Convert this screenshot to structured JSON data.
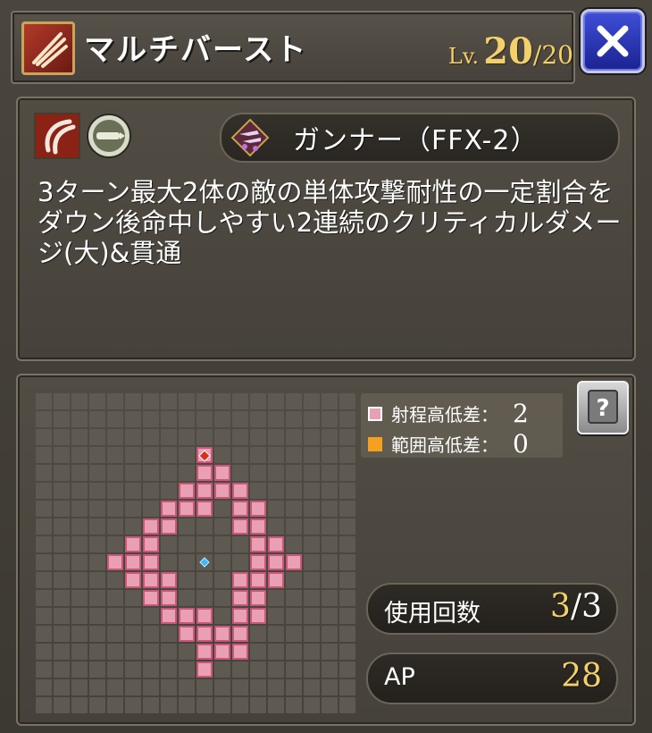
{
  "header": {
    "skill_name": "マルチバースト",
    "level_prefix": "Lv.",
    "level_current": "20",
    "level_separator": "/",
    "level_max": "20"
  },
  "ability": {
    "icons": [
      "claw-slash-icon",
      "bullet-ammo-icon"
    ],
    "job_icon": "dual-guns-icon",
    "job_name": "ガンナー（FFX-2）",
    "description": "3ターン最大2体の敵の単体攻撃耐性の一定割合をダウン後命中しやすい2連続のクリティカルダメージ(大)&貫通"
  },
  "range": {
    "legend": [
      {
        "label": "射程高低差：",
        "value": "2",
        "color": "#e9a0b4"
      },
      {
        "label": "範囲高低差：",
        "value": "0",
        "color": "#f4a020"
      }
    ],
    "grid_rows": [
      "..................",
      "..................",
      "..................",
      ".........T........",
      ".........XX.......",
      "........XXXX......",
      ".......XXX.XX.....",
      "......XX...XX.....",
      ".....XX.....XX....",
      "....XXX..C..XXX...",
      ".....XXX...XXX....",
      "......XX...XX.....",
      ".......XXX.XX.....",
      "........XXXX......",
      ".........XXX......",
      ".........X........",
      "..................",
      ".................."
    ]
  },
  "stats": {
    "uses_label": "使用回数",
    "uses_current": "3",
    "uses_separator": "/",
    "uses_max": "3",
    "ap_label": "AP",
    "ap_value": "28"
  },
  "colors": {
    "accent_gold": "#f4d06a",
    "range_pink": "#e9a0b4",
    "close_blue": "#2a36c0"
  }
}
